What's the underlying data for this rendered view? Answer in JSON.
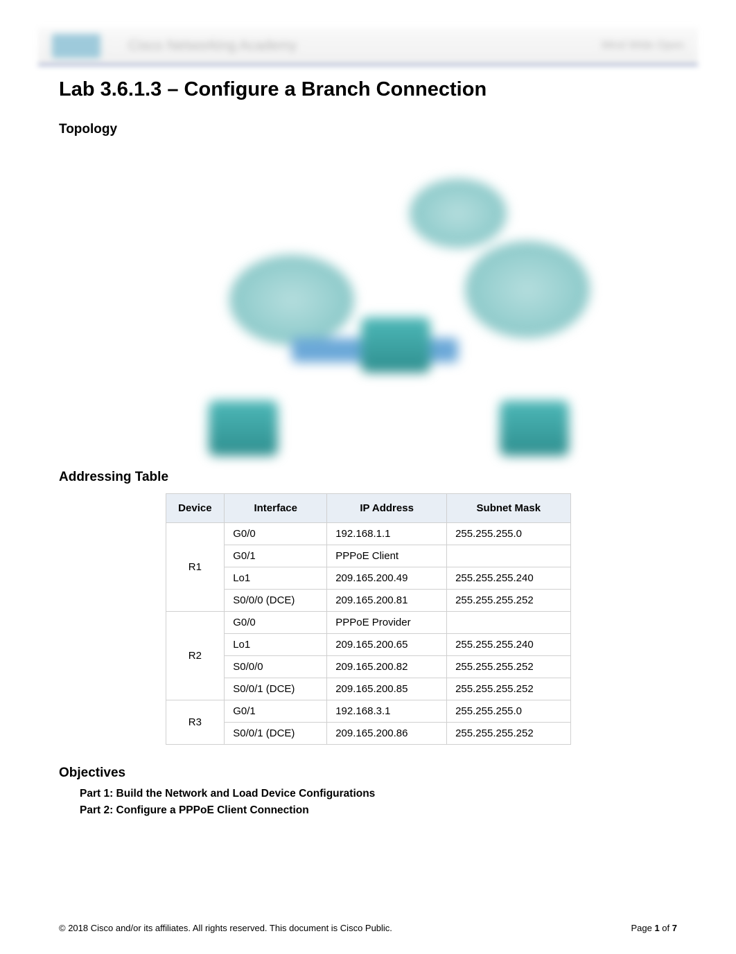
{
  "header": {
    "brand_text": "Cisco Networking Academy",
    "right_text": "Mind Wide Open"
  },
  "title": "Lab 3.6.1.3 – Configure a Branch Connection",
  "sections": {
    "topology_heading": "Topology",
    "addressing_heading": "Addressing Table",
    "objectives_heading": "Objectives"
  },
  "addressing_table": {
    "headers": {
      "device": "Device",
      "interface": "Interface",
      "ip": "IP Address",
      "mask": "Subnet Mask"
    },
    "rows": [
      {
        "device": "R1",
        "rowspan": 4,
        "interface": "G0/0",
        "ip": "192.168.1.1",
        "mask": "255.255.255.0"
      },
      {
        "interface": "G0/1",
        "ip": "PPPoE Client",
        "mask": ""
      },
      {
        "interface": "Lo1",
        "ip": "209.165.200.49",
        "mask": "255.255.255.240"
      },
      {
        "interface": "S0/0/0 (DCE)",
        "ip": "209.165.200.81",
        "mask": "255.255.255.252"
      },
      {
        "device": "R2",
        "rowspan": 4,
        "interface": "G0/0",
        "ip": "PPPoE Provider",
        "mask": ""
      },
      {
        "interface": "Lo1",
        "ip": "209.165.200.65",
        "mask": "255.255.255.240"
      },
      {
        "interface": "S0/0/0",
        "ip": "209.165.200.82",
        "mask": "255.255.255.252"
      },
      {
        "interface": "S0/0/1 (DCE)",
        "ip": "209.165.200.85",
        "mask": "255.255.255.252"
      },
      {
        "device": "R3",
        "rowspan": 2,
        "interface": "G0/1",
        "ip": "192.168.3.1",
        "mask": "255.255.255.0"
      },
      {
        "interface": "S0/0/1 (DCE)",
        "ip": "209.165.200.86",
        "mask": "255.255.255.252"
      }
    ]
  },
  "objectives": [
    "Part 1: Build the Network and Load Device Configurations",
    "Part 2: Configure a PPPoE Client Connection"
  ],
  "footer": {
    "copyright": "© 2018 Cisco and/or its affiliates. All rights reserved. This document is Cisco Public.",
    "page_label": "Page ",
    "page_current": "1",
    "page_of": " of ",
    "page_total": "7"
  }
}
